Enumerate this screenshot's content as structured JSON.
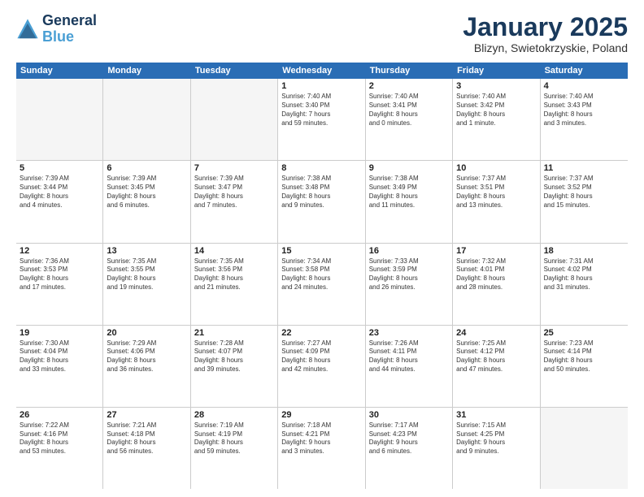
{
  "logo": {
    "line1": "General",
    "line2": "Blue"
  },
  "title": "January 2025",
  "subtitle": "Blizyn, Swietokrzyskie, Poland",
  "header_days": [
    "Sunday",
    "Monday",
    "Tuesday",
    "Wednesday",
    "Thursday",
    "Friday",
    "Saturday"
  ],
  "weeks": [
    [
      {
        "day": "",
        "text": "",
        "empty": true
      },
      {
        "day": "",
        "text": "",
        "empty": true
      },
      {
        "day": "",
        "text": "",
        "empty": true
      },
      {
        "day": "1",
        "text": "Sunrise: 7:40 AM\nSunset: 3:40 PM\nDaylight: 7 hours\nand 59 minutes.",
        "empty": false
      },
      {
        "day": "2",
        "text": "Sunrise: 7:40 AM\nSunset: 3:41 PM\nDaylight: 8 hours\nand 0 minutes.",
        "empty": false
      },
      {
        "day": "3",
        "text": "Sunrise: 7:40 AM\nSunset: 3:42 PM\nDaylight: 8 hours\nand 1 minute.",
        "empty": false
      },
      {
        "day": "4",
        "text": "Sunrise: 7:40 AM\nSunset: 3:43 PM\nDaylight: 8 hours\nand 3 minutes.",
        "empty": false
      }
    ],
    [
      {
        "day": "5",
        "text": "Sunrise: 7:39 AM\nSunset: 3:44 PM\nDaylight: 8 hours\nand 4 minutes.",
        "empty": false
      },
      {
        "day": "6",
        "text": "Sunrise: 7:39 AM\nSunset: 3:45 PM\nDaylight: 8 hours\nand 6 minutes.",
        "empty": false
      },
      {
        "day": "7",
        "text": "Sunrise: 7:39 AM\nSunset: 3:47 PM\nDaylight: 8 hours\nand 7 minutes.",
        "empty": false
      },
      {
        "day": "8",
        "text": "Sunrise: 7:38 AM\nSunset: 3:48 PM\nDaylight: 8 hours\nand 9 minutes.",
        "empty": false
      },
      {
        "day": "9",
        "text": "Sunrise: 7:38 AM\nSunset: 3:49 PM\nDaylight: 8 hours\nand 11 minutes.",
        "empty": false
      },
      {
        "day": "10",
        "text": "Sunrise: 7:37 AM\nSunset: 3:51 PM\nDaylight: 8 hours\nand 13 minutes.",
        "empty": false
      },
      {
        "day": "11",
        "text": "Sunrise: 7:37 AM\nSunset: 3:52 PM\nDaylight: 8 hours\nand 15 minutes.",
        "empty": false
      }
    ],
    [
      {
        "day": "12",
        "text": "Sunrise: 7:36 AM\nSunset: 3:53 PM\nDaylight: 8 hours\nand 17 minutes.",
        "empty": false
      },
      {
        "day": "13",
        "text": "Sunrise: 7:35 AM\nSunset: 3:55 PM\nDaylight: 8 hours\nand 19 minutes.",
        "empty": false
      },
      {
        "day": "14",
        "text": "Sunrise: 7:35 AM\nSunset: 3:56 PM\nDaylight: 8 hours\nand 21 minutes.",
        "empty": false
      },
      {
        "day": "15",
        "text": "Sunrise: 7:34 AM\nSunset: 3:58 PM\nDaylight: 8 hours\nand 24 minutes.",
        "empty": false
      },
      {
        "day": "16",
        "text": "Sunrise: 7:33 AM\nSunset: 3:59 PM\nDaylight: 8 hours\nand 26 minutes.",
        "empty": false
      },
      {
        "day": "17",
        "text": "Sunrise: 7:32 AM\nSunset: 4:01 PM\nDaylight: 8 hours\nand 28 minutes.",
        "empty": false
      },
      {
        "day": "18",
        "text": "Sunrise: 7:31 AM\nSunset: 4:02 PM\nDaylight: 8 hours\nand 31 minutes.",
        "empty": false
      }
    ],
    [
      {
        "day": "19",
        "text": "Sunrise: 7:30 AM\nSunset: 4:04 PM\nDaylight: 8 hours\nand 33 minutes.",
        "empty": false
      },
      {
        "day": "20",
        "text": "Sunrise: 7:29 AM\nSunset: 4:06 PM\nDaylight: 8 hours\nand 36 minutes.",
        "empty": false
      },
      {
        "day": "21",
        "text": "Sunrise: 7:28 AM\nSunset: 4:07 PM\nDaylight: 8 hours\nand 39 minutes.",
        "empty": false
      },
      {
        "day": "22",
        "text": "Sunrise: 7:27 AM\nSunset: 4:09 PM\nDaylight: 8 hours\nand 42 minutes.",
        "empty": false
      },
      {
        "day": "23",
        "text": "Sunrise: 7:26 AM\nSunset: 4:11 PM\nDaylight: 8 hours\nand 44 minutes.",
        "empty": false
      },
      {
        "day": "24",
        "text": "Sunrise: 7:25 AM\nSunset: 4:12 PM\nDaylight: 8 hours\nand 47 minutes.",
        "empty": false
      },
      {
        "day": "25",
        "text": "Sunrise: 7:23 AM\nSunset: 4:14 PM\nDaylight: 8 hours\nand 50 minutes.",
        "empty": false
      }
    ],
    [
      {
        "day": "26",
        "text": "Sunrise: 7:22 AM\nSunset: 4:16 PM\nDaylight: 8 hours\nand 53 minutes.",
        "empty": false
      },
      {
        "day": "27",
        "text": "Sunrise: 7:21 AM\nSunset: 4:18 PM\nDaylight: 8 hours\nand 56 minutes.",
        "empty": false
      },
      {
        "day": "28",
        "text": "Sunrise: 7:19 AM\nSunset: 4:19 PM\nDaylight: 8 hours\nand 59 minutes.",
        "empty": false
      },
      {
        "day": "29",
        "text": "Sunrise: 7:18 AM\nSunset: 4:21 PM\nDaylight: 9 hours\nand 3 minutes.",
        "empty": false
      },
      {
        "day": "30",
        "text": "Sunrise: 7:17 AM\nSunset: 4:23 PM\nDaylight: 9 hours\nand 6 minutes.",
        "empty": false
      },
      {
        "day": "31",
        "text": "Sunrise: 7:15 AM\nSunset: 4:25 PM\nDaylight: 9 hours\nand 9 minutes.",
        "empty": false
      },
      {
        "day": "",
        "text": "",
        "empty": true
      }
    ]
  ]
}
